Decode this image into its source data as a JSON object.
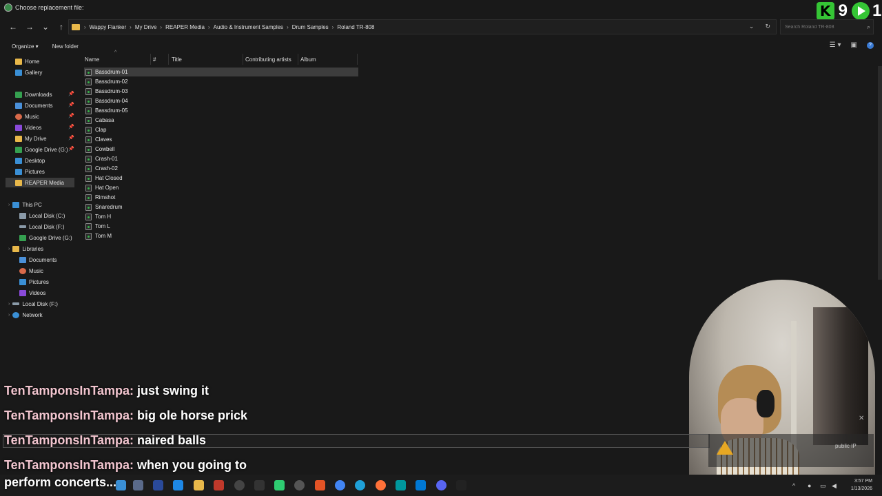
{
  "window": {
    "title": "Choose replacement file:"
  },
  "overlay": {
    "counter_left": "9",
    "counter_right": "1",
    "k_letter": "K"
  },
  "breadcrumb": [
    "Wappy Flanker",
    "My Drive",
    "REAPER Media",
    "Audio & Instrument Samples",
    "Drum Samples",
    "Roland TR-808"
  ],
  "search": {
    "placeholder": "Search Roland TR-808"
  },
  "toolbar": {
    "organize": "Organize ▾",
    "new_folder": "New folder"
  },
  "sidebar": {
    "quick": [
      {
        "label": "Home",
        "color": "#e8b84a"
      },
      {
        "label": "Gallery",
        "color": "#3a8fd5"
      }
    ],
    "pinned": [
      {
        "label": "Downloads",
        "color": "#35a050"
      },
      {
        "label": "Documents",
        "color": "#4a90d9"
      },
      {
        "label": "Music",
        "color": "#d96a4a"
      },
      {
        "label": "Videos",
        "color": "#8a4ad9"
      },
      {
        "label": "My Drive",
        "color": "#e8b84a"
      },
      {
        "label": "Google Drive (G:)",
        "color": "#35a050"
      },
      {
        "label": "Desktop",
        "color": "#3a8fd5"
      },
      {
        "label": "Pictures",
        "color": "#3a8fd5"
      },
      {
        "label": "REAPER Media",
        "color": "#e8b84a"
      }
    ],
    "this_pc": {
      "label": "This PC"
    },
    "pc_items": [
      {
        "label": "Local Disk (C:)"
      },
      {
        "label": "Local Disk (F:)"
      },
      {
        "label": "Google Drive (G:)"
      }
    ],
    "libraries": {
      "label": "Libraries"
    },
    "lib_items": [
      {
        "label": "Documents"
      },
      {
        "label": "Music"
      },
      {
        "label": "Pictures"
      },
      {
        "label": "Videos"
      }
    ],
    "local_f": {
      "label": "Local Disk (F:)"
    },
    "network": {
      "label": "Network"
    }
  },
  "columns": {
    "name": "Name",
    "number": "#",
    "title": "Title",
    "artists": "Contributing artists",
    "album": "Album"
  },
  "files": [
    "Bassdrum-01",
    "Bassdrum-02",
    "Bassdrum-03",
    "Bassdrum-04",
    "Bassdrum-05",
    "Cabasa",
    "Clap",
    "Claves",
    "Cowbell",
    "Crash-01",
    "Crash-02",
    "Hat Closed",
    "Hat Open",
    "Rimshot",
    "Snaredrum",
    "Tom H",
    "Tom L",
    "Tom M"
  ],
  "selected_file": "Bassdrum-01",
  "chat": [
    {
      "user": "TenTamponsInTampa:",
      "message": "just swing it"
    },
    {
      "user": "TenTamponsInTampa:",
      "message": "big ole horse prick"
    },
    {
      "user": "TenTamponsInTampa:",
      "message": "naired balls"
    },
    {
      "user": "TenTamponsInTampa:",
      "message": "when you going to"
    },
    {
      "user": "",
      "message": "perform concerts..."
    }
  ],
  "notification": {
    "text": "public IP"
  },
  "clock": {
    "time": "3:57 PM",
    "date": "1/13/2026"
  }
}
